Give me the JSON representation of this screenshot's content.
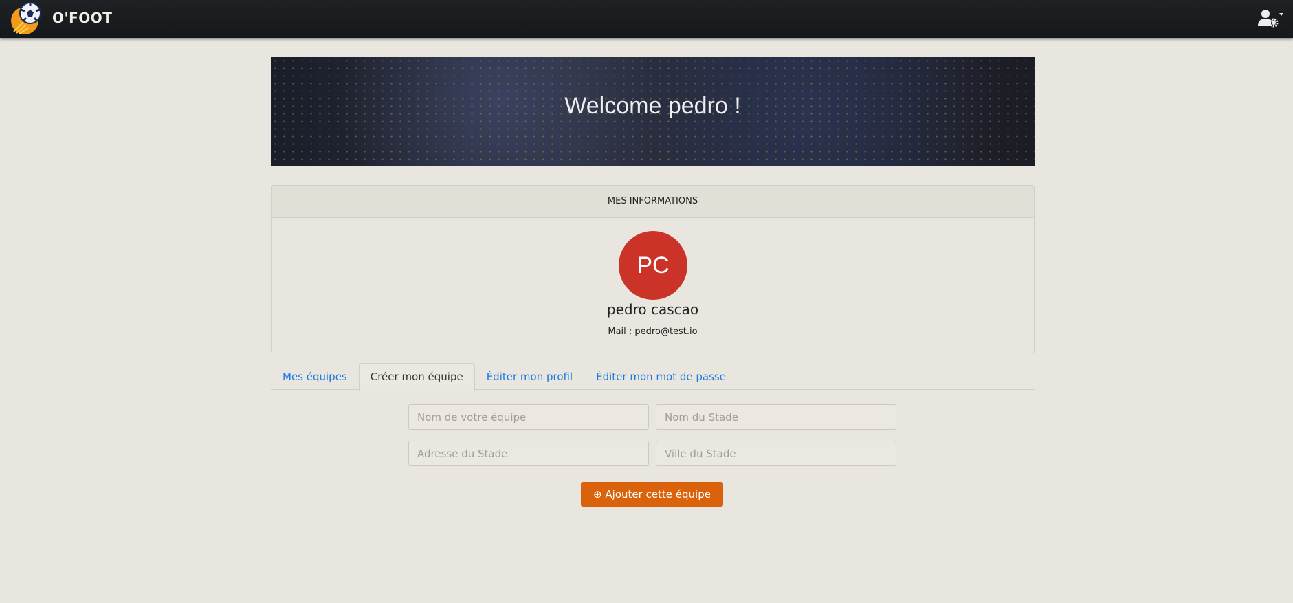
{
  "nav": {
    "brand": "O'FOOT",
    "logo_icon": "soccer-ball-logo",
    "user_icon": "user-cog-icon"
  },
  "banner": {
    "title": "Welcome pedro !"
  },
  "info": {
    "header": "MES INFORMATIONS",
    "initials": "PC",
    "name": "pedro cascao",
    "mail": "Mail : pedro@test.io",
    "avatar_color": "#cc3328"
  },
  "tabs": [
    {
      "label": "Mes équipes"
    },
    {
      "label": "Créer mon équipe",
      "active": true
    },
    {
      "label": "Éditer mon profil"
    },
    {
      "label": "Éditer mon mot de passe"
    }
  ],
  "form": {
    "team_name": "Nom de votre équipe",
    "stadium_name": "Nom du Stade",
    "stadium_address": "Adresse du Stade",
    "stadium_city": "Ville du Stade",
    "submit": "Ajouter cette équipe",
    "accent": "#d9620a"
  }
}
